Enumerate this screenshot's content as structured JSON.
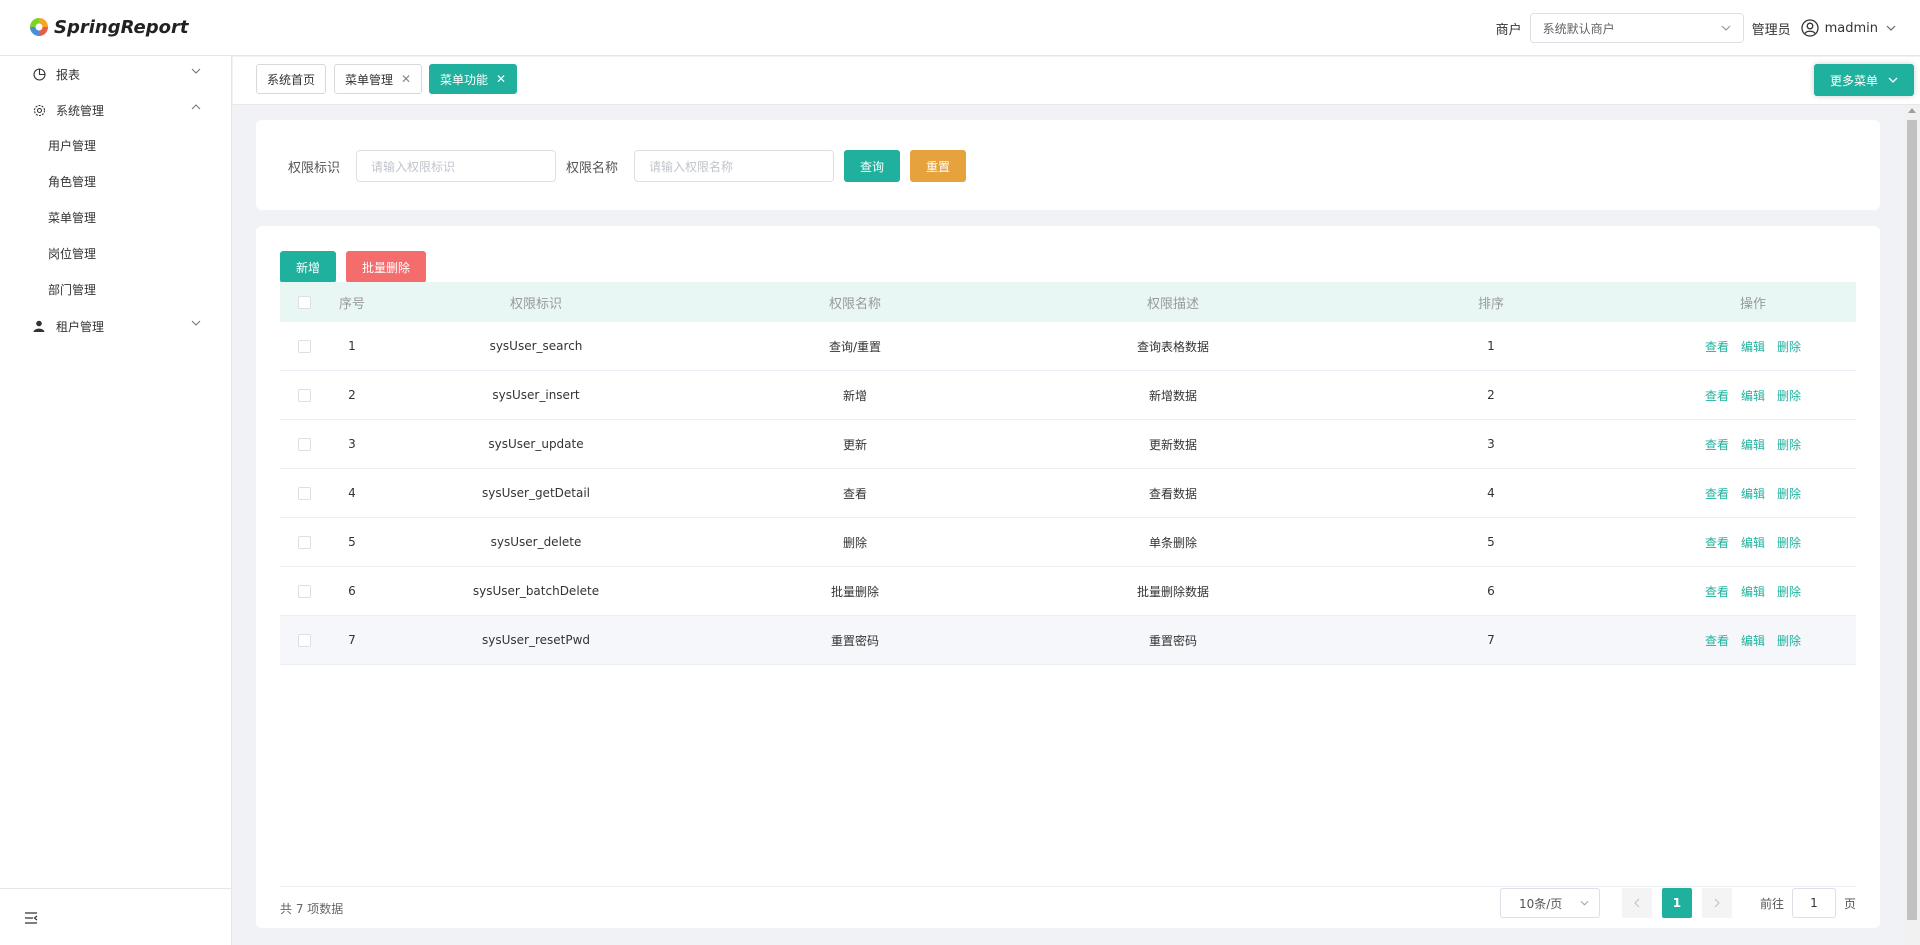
{
  "header": {
    "brand": "SpringReport",
    "tenant_label": "商户",
    "tenant_value": "系统默认商户",
    "role": "管理员",
    "username": "madmin"
  },
  "sidebar": {
    "items": [
      {
        "label": "报表"
      },
      {
        "label": "系统管理"
      },
      {
        "label": "租户管理"
      }
    ],
    "sub_items": [
      {
        "label": "用户管理"
      },
      {
        "label": "角色管理"
      },
      {
        "label": "菜单管理"
      },
      {
        "label": "岗位管理"
      },
      {
        "label": "部门管理"
      }
    ]
  },
  "tabs": [
    {
      "label": "系统首页"
    },
    {
      "label": "菜单管理"
    },
    {
      "label": "菜单功能"
    }
  ],
  "more_menu": "更多菜单",
  "search": {
    "code_label": "权限标识",
    "code_placeholder": "请输入权限标识",
    "name_label": "权限名称",
    "name_placeholder": "请输入权限名称",
    "query_button": "查询",
    "reset_button": "重置"
  },
  "toolbar": {
    "add_button": "新增",
    "batch_delete_button": "批量删除"
  },
  "table": {
    "headers": [
      "序号",
      "权限标识",
      "权限名称",
      "权限描述",
      "排序",
      "操作"
    ],
    "rows": [
      {
        "no": "1",
        "code": "sysUser_search",
        "name": "查询/重置",
        "desc": "查询表格数据",
        "sort": "1"
      },
      {
        "no": "2",
        "code": "sysUser_insert",
        "name": "新增",
        "desc": "新增数据",
        "sort": "2"
      },
      {
        "no": "3",
        "code": "sysUser_update",
        "name": "更新",
        "desc": "更新数据",
        "sort": "3"
      },
      {
        "no": "4",
        "code": "sysUser_getDetail",
        "name": "查看",
        "desc": "查看数据",
        "sort": "4"
      },
      {
        "no": "5",
        "code": "sysUser_delete",
        "name": "删除",
        "desc": "单条删除",
        "sort": "5"
      },
      {
        "no": "6",
        "code": "sysUser_batchDelete",
        "name": "批量删除",
        "desc": "批量删除数据",
        "sort": "6"
      },
      {
        "no": "7",
        "code": "sysUser_resetPwd",
        "name": "重置密码",
        "desc": "重置密码",
        "sort": "7"
      }
    ],
    "actions": {
      "view": "查看",
      "edit": "编辑",
      "delete": "删除"
    }
  },
  "pagination": {
    "total": "共 7 项数据",
    "page_size": "10条/页",
    "current_page": "1",
    "goto_label": "前往",
    "goto_value": "1",
    "page_suffix": "页"
  },
  "colors": {
    "primary": "#1fb19e",
    "warning": "#e6a23c",
    "danger": "#f56c6c"
  }
}
